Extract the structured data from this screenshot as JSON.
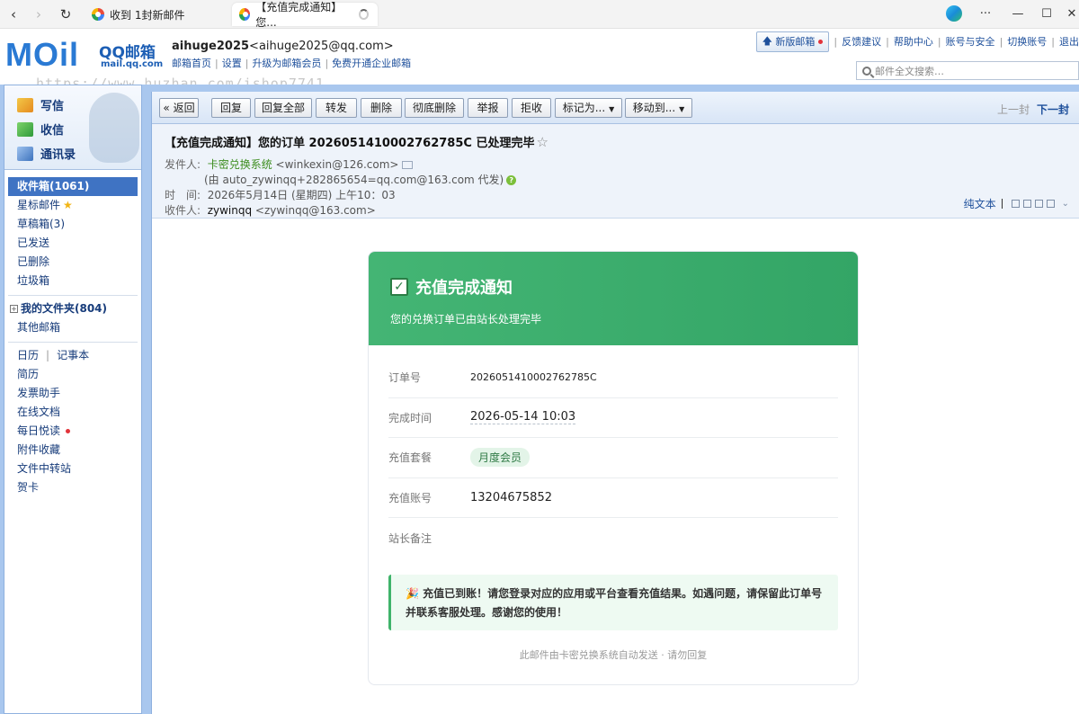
{
  "browser": {
    "tabs": [
      {
        "label": "收到 1封新邮件"
      },
      {
        "label": "【充值完成通知】您..."
      }
    ]
  },
  "header": {
    "logo_text": "MOil",
    "logo_brand": "QQ邮箱",
    "logo_url": "mail.qq.com",
    "user_name": "aihuge2025",
    "user_email": "<aihuge2025@qq.com>",
    "user_links": [
      "邮箱首页",
      "设置",
      "升级为邮箱会员",
      "免费开通企业邮箱"
    ],
    "new_version": "新版邮箱",
    "top_links": [
      "反馈建议",
      "帮助中心",
      "账号与安全",
      "切换账号",
      "退出"
    ],
    "search_placeholder": "邮件全文搜索…",
    "watermark": "https://www.huzhan.com/ishop7741"
  },
  "sidebar": {
    "quick": [
      {
        "label": "写信",
        "icon": "pencil-icon"
      },
      {
        "label": "收信",
        "icon": "inbox-download-icon"
      },
      {
        "label": "通讯录",
        "icon": "contacts-icon"
      }
    ],
    "inbox": "收件箱(1061)",
    "starred": "星标邮件",
    "drafts": "草稿箱(3)",
    "sent": "已发送",
    "deleted": "已删除",
    "trash": "垃圾箱",
    "my_folders": "我的文件夹(804)",
    "other": "其他邮箱",
    "calendar": "日历",
    "notes": "记事本",
    "tools": [
      "简历",
      "发票助手",
      "在线文档",
      "每日悦读",
      "附件收藏",
      "文件中转站",
      "贺卡"
    ]
  },
  "toolbar": {
    "back": "« 返回",
    "reply": "回复",
    "reply_all": "回复全部",
    "forward": "转发",
    "delete": "删除",
    "delete_perm": "彻底删除",
    "report": "举报",
    "reject": "拒收",
    "mark_as": "标记为...",
    "move_to": "移动到...",
    "prev": "上一封",
    "next": "下一封"
  },
  "mail": {
    "subject": "【充值完成通知】您的订单 2026051410002762785C 已处理完毕",
    "from_label": "发件人:",
    "from_name": "卡密兑换系统",
    "from_email": "<winkexin@126.com>",
    "via": "(由 auto_zywinqq+282865654=qq.com@163.com 代发)",
    "time_label": "时　间:",
    "time_value": "2026年5月14日 (星期四) 上午10：03",
    "to_label": "收件人:",
    "to_name": "zywinqq",
    "to_email": "<zywinqq@163.com>",
    "plain_text": "纯文本"
  },
  "card": {
    "title": "充值完成通知",
    "subtitle": "您的兑换订单已由站长处理完毕",
    "rows": [
      {
        "k": "订单号",
        "v": "2026051410002762785C"
      },
      {
        "k": "完成时间",
        "v": "2026-05-14 10:03"
      },
      {
        "k": "充值套餐",
        "v": "月度会员"
      },
      {
        "k": "充值账号",
        "v": "13204675852"
      },
      {
        "k": "站长备注",
        "v": ""
      }
    ],
    "notice_icon": "🎉",
    "notice": "充值已到账！请您登录对应的应用或平台查看充值结果。如遇问题，请保留此订单号并联系客服处理。感谢您的使用！",
    "footer": "此邮件由卡密兑换系统自动发送 · 请勿回复"
  },
  "colors": {
    "accent": "#3f73c3",
    "green": "#3aac6c",
    "frame": "#a9c7ee"
  }
}
